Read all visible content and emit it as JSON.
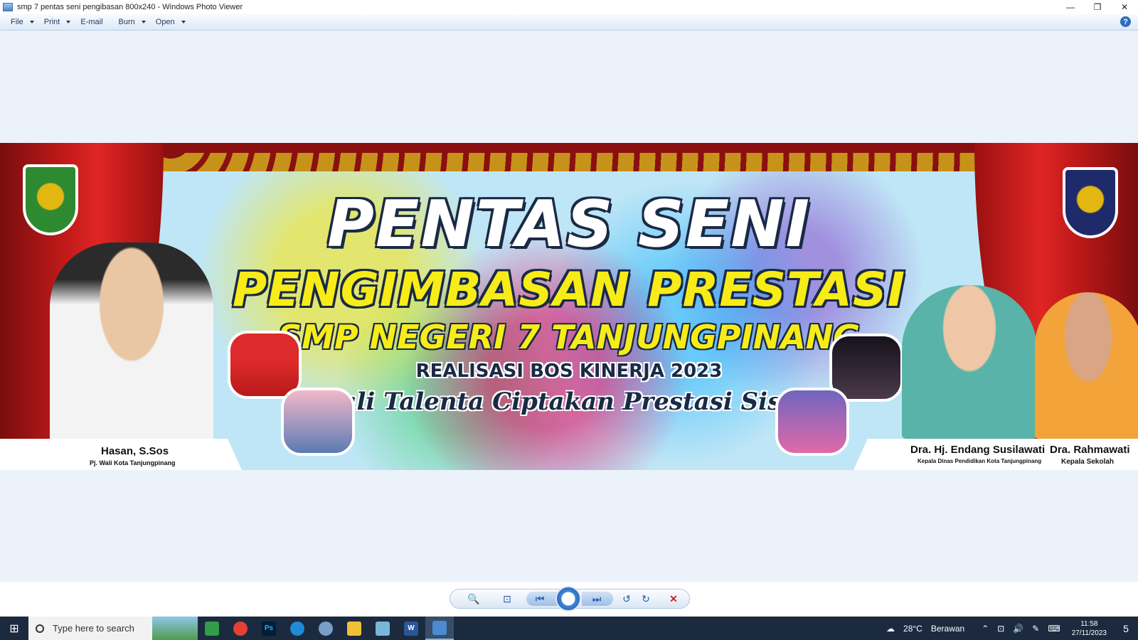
{
  "window": {
    "title": "smp 7 pentas seni pengibasan 800x240 - Windows Photo Viewer",
    "controls": {
      "minimize": "—",
      "restore": "❐",
      "close": "✕"
    }
  },
  "menu": {
    "items": [
      {
        "label": "File",
        "has_dropdown": true
      },
      {
        "label": "Print",
        "has_dropdown": true
      },
      {
        "label": "E-mail",
        "has_dropdown": false
      },
      {
        "label": "Burn",
        "has_dropdown": true
      },
      {
        "label": "Open",
        "has_dropdown": true
      }
    ],
    "help": "?"
  },
  "banner": {
    "title_main": "PENTAS SENI",
    "title_sub": "PENGIMBASAN  PRESTASI",
    "school": "SMP NEGERI 7 TANJUNGPINANG",
    "realisasi": "REALISASI BOS KINERJA 2023",
    "tagline": "Gali Talenta Ciptakan Prestasi Siswa",
    "people": {
      "left": {
        "name": "Hasan, S.Sos",
        "role": "Pj. Wali Kota Tanjungpinang"
      },
      "middle": {
        "name": "Dra. Hj. Endang Susilawati",
        "role": "Kepala Dinas Pendidikan Kota Tanjungpinang"
      },
      "right": {
        "name": "Dra. Rahmawati",
        "role": "Kepala Sekolah"
      }
    },
    "colors": {
      "curtain": "#c21a1a",
      "title_yellow": "#f7ec17",
      "outline": "#1a2a45"
    }
  },
  "viewer_toolbar": {
    "zoom": "🔍",
    "fit": "⊡",
    "previous": "⏮",
    "slideshow": "",
    "next": "⏭",
    "rotate_ccw": "↺",
    "rotate_cw": "↻",
    "delete": "✕"
  },
  "taskbar": {
    "start": "⊞",
    "search_placeholder": "Type here to search",
    "apps": [
      {
        "name": "green-app",
        "glyph": "",
        "color": "#2f9e44"
      },
      {
        "name": "chrome",
        "glyph": "",
        "color": "#e44134"
      },
      {
        "name": "photoshop",
        "glyph": "Ps",
        "color": "#001e36"
      },
      {
        "name": "edge",
        "glyph": "",
        "color": "#1f8ad6"
      },
      {
        "name": "paint",
        "glyph": "",
        "color": "#7a9fc7"
      },
      {
        "name": "file-explorer",
        "glyph": "",
        "color": "#f2c037"
      },
      {
        "name": "notepad",
        "glyph": "",
        "color": "#78b7d8"
      },
      {
        "name": "word",
        "glyph": "W",
        "color": "#2b579a"
      },
      {
        "name": "photo-viewer",
        "glyph": "",
        "color": "#4a8bd1"
      }
    ],
    "weather": {
      "temp": "28°C",
      "condition": "Berawan"
    },
    "clock": {
      "time": "11:58",
      "date": "27/11/2023"
    },
    "notifications": "5"
  }
}
